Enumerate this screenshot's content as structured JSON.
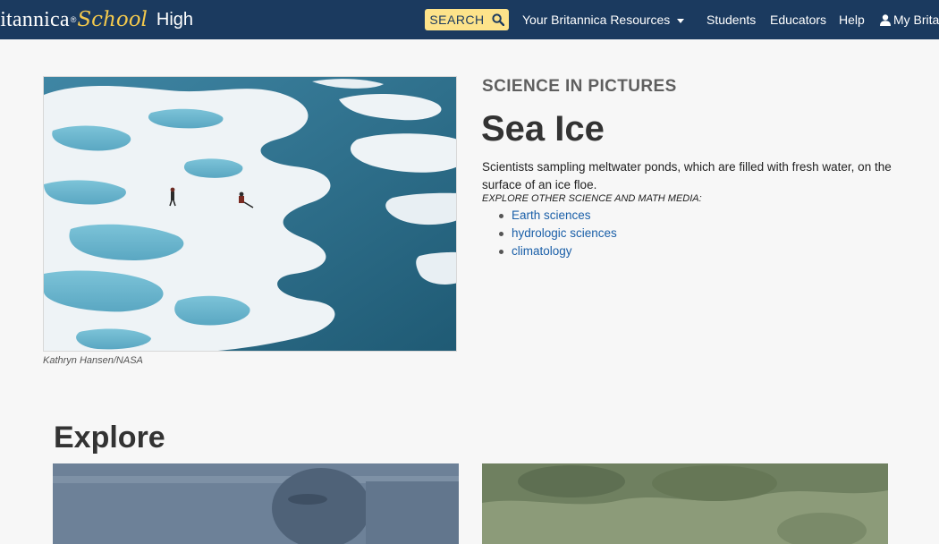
{
  "header": {
    "brand": {
      "part1": "ritannica",
      "reg": "®",
      "part2": "School",
      "part3": "High"
    },
    "search_label": "SEARCH",
    "nav": {
      "resources": "Your Britannica Resources",
      "students": "Students",
      "educators": "Educators",
      "help": "Help",
      "account": "My Brita"
    }
  },
  "hero": {
    "credit": "Kathryn Hansen/NASA"
  },
  "article": {
    "eyebrow": "SCIENCE IN PICTURES",
    "title": "Sea Ice",
    "caption": "Scientists sampling meltwater ponds, which are filled with fresh water, on the surface of an ice floe.",
    "explore_label": "EXPLORE OTHER SCIENCE AND MATH MEDIA:",
    "links": [
      "Earth sciences",
      "hydrologic sciences",
      "climatology"
    ]
  },
  "explore": {
    "title": "Explore"
  },
  "colors": {
    "nav_bg": "#1b3a5f",
    "brand_accent": "#f3c94d",
    "search_bg": "#fde38a",
    "link": "#1a5fa8"
  },
  "icons": {
    "search": "search-icon",
    "dropdown": "caret-down-icon",
    "account": "user-icon"
  }
}
